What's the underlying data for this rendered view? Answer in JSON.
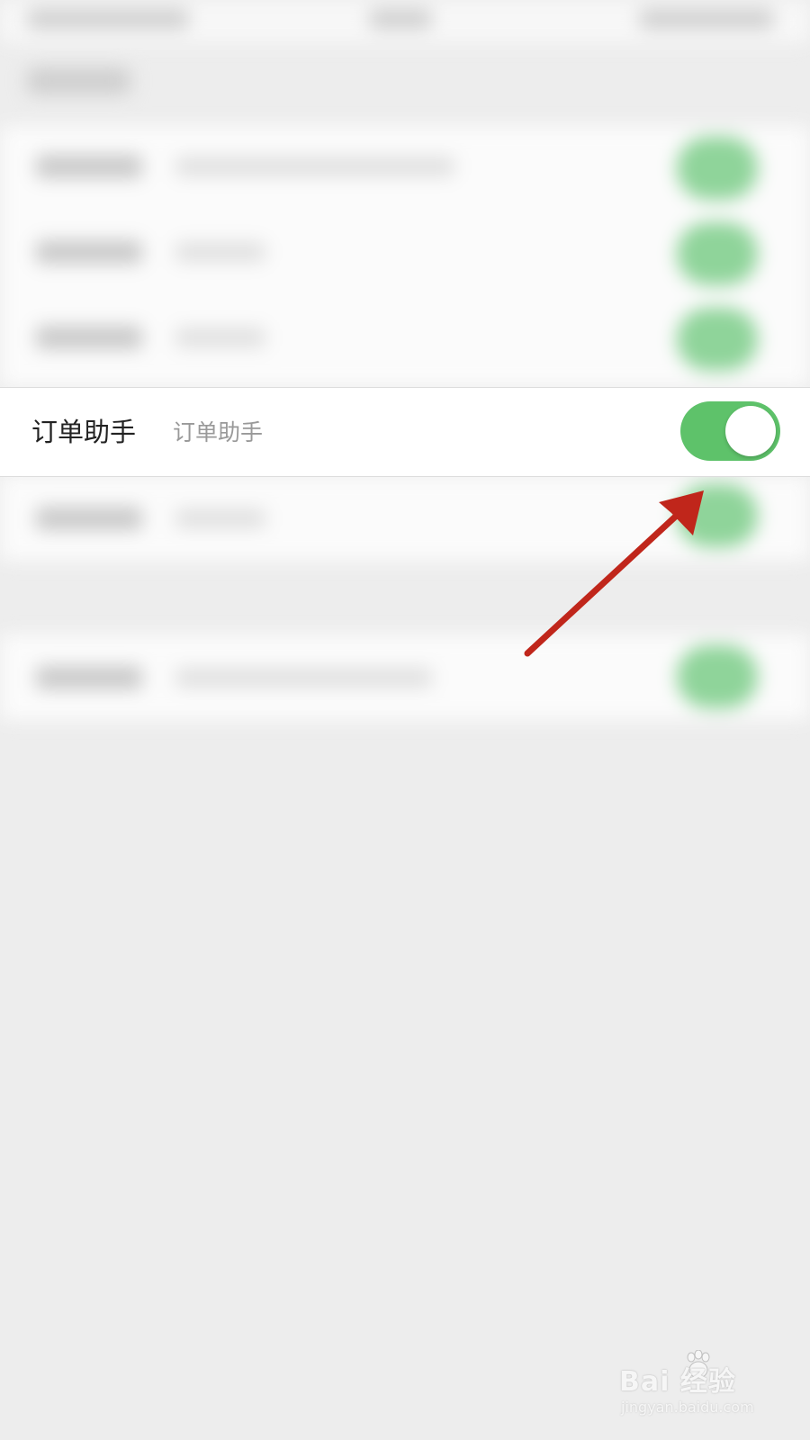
{
  "settings": {
    "focused_item": {
      "label": "订单助手",
      "description": "订单助手",
      "toggle_on": true
    }
  },
  "colors": {
    "toggle_on": "#5ec26a",
    "arrow": "#c0261b",
    "page_background": "#ededed"
  },
  "watermark": {
    "brand": "Bai  经验",
    "site": "jingyan.baidu.com"
  }
}
